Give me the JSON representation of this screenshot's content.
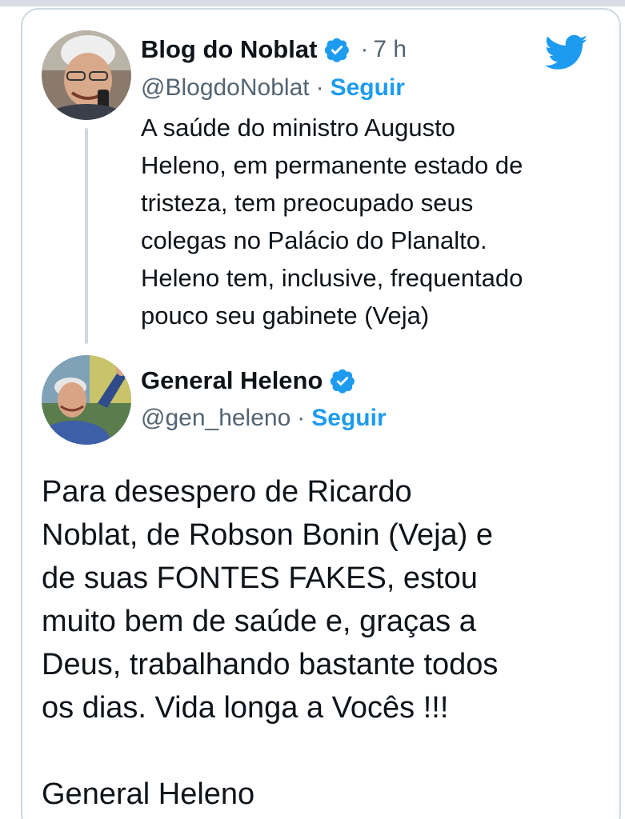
{
  "colors": {
    "accent": "#1d9bf0",
    "text_primary": "#0f1419",
    "text_secondary": "#536471",
    "border": "#cfd9de"
  },
  "quoted_tweet": {
    "author_name": "Blog do Noblat",
    "verified": true,
    "verified_icon": "verified-badge-icon",
    "separator": "·",
    "timestamp": "7 h",
    "handle": "@BlogdoNoblat",
    "handle_separator": "·",
    "follow_label": "Seguir",
    "text": "A saúde do ministro Augusto\nHeleno, em permanente estado de\ntristeza, tem preocupado seus\ncolegas no Palácio do Planalto.\nHeleno tem, inclusive, frequentado\npouco seu gabinete (Veja)"
  },
  "reply_tweet": {
    "author_name": "General Heleno",
    "verified": true,
    "verified_icon": "verified-badge-icon",
    "handle": "@gen_heleno",
    "handle_separator": "·",
    "follow_label": "Seguir",
    "text": "Para desespero de Ricardo\nNoblat, de Robson Bonin  (Veja) e\nde suas FONTES FAKES, estou\nmuito bem de saúde e, graças a\nDeus, trabalhando bastante todos\nos dias. Vida longa a Vocês !!!\n\nGeneral Heleno"
  },
  "brand_icon": "twitter-bird-icon"
}
